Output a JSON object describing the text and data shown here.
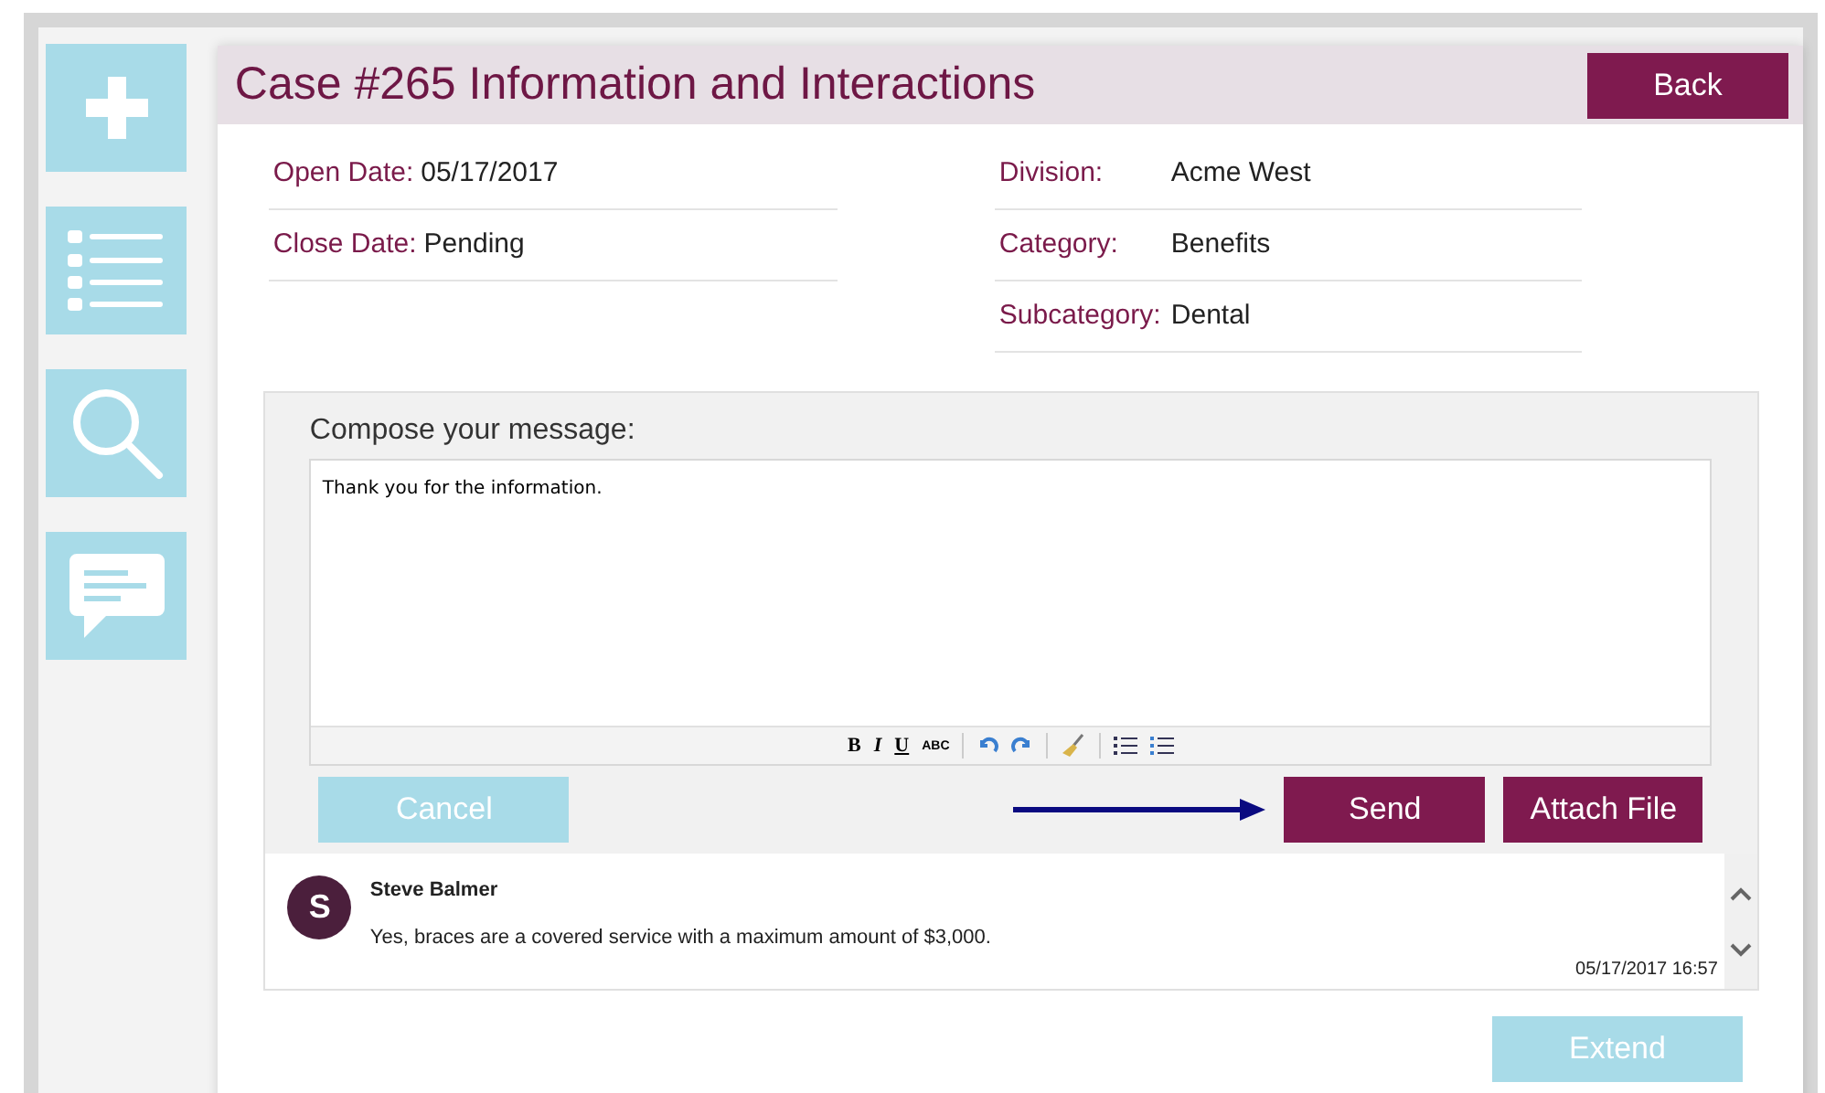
{
  "header": {
    "title": "Case #265 Information and Interactions",
    "back_button": "Back"
  },
  "fields_left": [
    {
      "label": "Open Date:",
      "value": "05/17/2017"
    },
    {
      "label": "Close Date:",
      "value": "Pending"
    }
  ],
  "fields_right": [
    {
      "label": "Division:",
      "value": "Acme West"
    },
    {
      "label": "Category:",
      "value": "Benefits"
    },
    {
      "label": "Subcategory:",
      "value": "Dental"
    }
  ],
  "compose": {
    "label": "Compose your message:",
    "value": "Thank you for the information.",
    "toolbar_text_buttons": [
      {
        "label": "B",
        "kind": "bold"
      },
      {
        "label": "I",
        "kind": "italic"
      },
      {
        "label": "U",
        "kind": "underline"
      },
      {
        "label": "ABC",
        "kind": "spell"
      }
    ],
    "cancel_button": "Cancel",
    "send_button": "Send",
    "attach_button": "Attach File"
  },
  "messages": [
    {
      "avatar": "S",
      "author": "Steve Balmer",
      "text": "Yes, braces are a covered service with a maximum amount of $3,000.",
      "time": "05/17/2017 16:57"
    }
  ],
  "extend_button": "Extend"
}
